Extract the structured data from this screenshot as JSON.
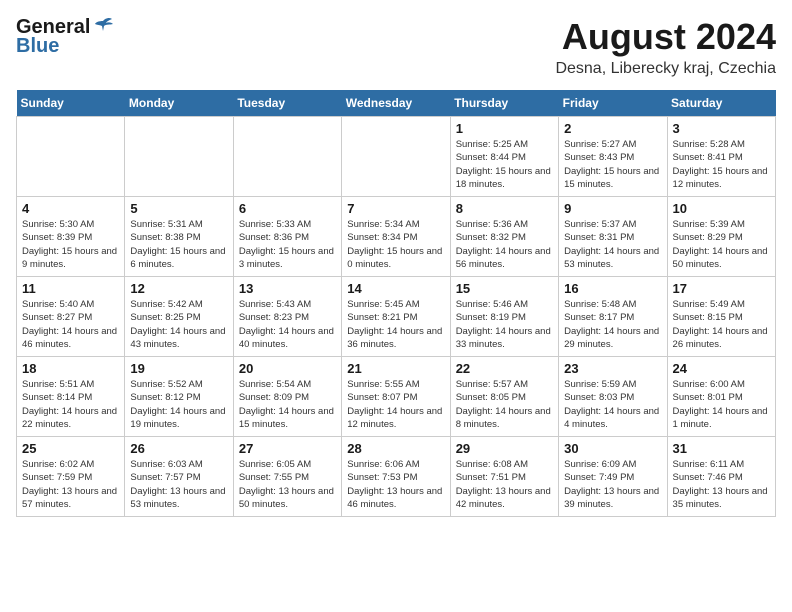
{
  "header": {
    "logo_general": "General",
    "logo_blue": "Blue",
    "month": "August 2024",
    "location": "Desna, Liberecky kraj, Czechia"
  },
  "columns": [
    "Sunday",
    "Monday",
    "Tuesday",
    "Wednesday",
    "Thursday",
    "Friday",
    "Saturday"
  ],
  "weeks": [
    [
      {
        "day": "",
        "empty": true
      },
      {
        "day": "",
        "empty": true
      },
      {
        "day": "",
        "empty": true
      },
      {
        "day": "",
        "empty": true
      },
      {
        "day": "1",
        "sunrise": "5:25 AM",
        "sunset": "8:44 PM",
        "daylight": "15 hours and 18 minutes."
      },
      {
        "day": "2",
        "sunrise": "5:27 AM",
        "sunset": "8:43 PM",
        "daylight": "15 hours and 15 minutes."
      },
      {
        "day": "3",
        "sunrise": "5:28 AM",
        "sunset": "8:41 PM",
        "daylight": "15 hours and 12 minutes."
      }
    ],
    [
      {
        "day": "4",
        "sunrise": "5:30 AM",
        "sunset": "8:39 PM",
        "daylight": "15 hours and 9 minutes."
      },
      {
        "day": "5",
        "sunrise": "5:31 AM",
        "sunset": "8:38 PM",
        "daylight": "15 hours and 6 minutes."
      },
      {
        "day": "6",
        "sunrise": "5:33 AM",
        "sunset": "8:36 PM",
        "daylight": "15 hours and 3 minutes."
      },
      {
        "day": "7",
        "sunrise": "5:34 AM",
        "sunset": "8:34 PM",
        "daylight": "15 hours and 0 minutes."
      },
      {
        "day": "8",
        "sunrise": "5:36 AM",
        "sunset": "8:32 PM",
        "daylight": "14 hours and 56 minutes."
      },
      {
        "day": "9",
        "sunrise": "5:37 AM",
        "sunset": "8:31 PM",
        "daylight": "14 hours and 53 minutes."
      },
      {
        "day": "10",
        "sunrise": "5:39 AM",
        "sunset": "8:29 PM",
        "daylight": "14 hours and 50 minutes."
      }
    ],
    [
      {
        "day": "11",
        "sunrise": "5:40 AM",
        "sunset": "8:27 PM",
        "daylight": "14 hours and 46 minutes."
      },
      {
        "day": "12",
        "sunrise": "5:42 AM",
        "sunset": "8:25 PM",
        "daylight": "14 hours and 43 minutes."
      },
      {
        "day": "13",
        "sunrise": "5:43 AM",
        "sunset": "8:23 PM",
        "daylight": "14 hours and 40 minutes."
      },
      {
        "day": "14",
        "sunrise": "5:45 AM",
        "sunset": "8:21 PM",
        "daylight": "14 hours and 36 minutes."
      },
      {
        "day": "15",
        "sunrise": "5:46 AM",
        "sunset": "8:19 PM",
        "daylight": "14 hours and 33 minutes."
      },
      {
        "day": "16",
        "sunrise": "5:48 AM",
        "sunset": "8:17 PM",
        "daylight": "14 hours and 29 minutes."
      },
      {
        "day": "17",
        "sunrise": "5:49 AM",
        "sunset": "8:15 PM",
        "daylight": "14 hours and 26 minutes."
      }
    ],
    [
      {
        "day": "18",
        "sunrise": "5:51 AM",
        "sunset": "8:14 PM",
        "daylight": "14 hours and 22 minutes."
      },
      {
        "day": "19",
        "sunrise": "5:52 AM",
        "sunset": "8:12 PM",
        "daylight": "14 hours and 19 minutes."
      },
      {
        "day": "20",
        "sunrise": "5:54 AM",
        "sunset": "8:09 PM",
        "daylight": "14 hours and 15 minutes."
      },
      {
        "day": "21",
        "sunrise": "5:55 AM",
        "sunset": "8:07 PM",
        "daylight": "14 hours and 12 minutes."
      },
      {
        "day": "22",
        "sunrise": "5:57 AM",
        "sunset": "8:05 PM",
        "daylight": "14 hours and 8 minutes."
      },
      {
        "day": "23",
        "sunrise": "5:59 AM",
        "sunset": "8:03 PM",
        "daylight": "14 hours and 4 minutes."
      },
      {
        "day": "24",
        "sunrise": "6:00 AM",
        "sunset": "8:01 PM",
        "daylight": "14 hours and 1 minute."
      }
    ],
    [
      {
        "day": "25",
        "sunrise": "6:02 AM",
        "sunset": "7:59 PM",
        "daylight": "13 hours and 57 minutes."
      },
      {
        "day": "26",
        "sunrise": "6:03 AM",
        "sunset": "7:57 PM",
        "daylight": "13 hours and 53 minutes."
      },
      {
        "day": "27",
        "sunrise": "6:05 AM",
        "sunset": "7:55 PM",
        "daylight": "13 hours and 50 minutes."
      },
      {
        "day": "28",
        "sunrise": "6:06 AM",
        "sunset": "7:53 PM",
        "daylight": "13 hours and 46 minutes."
      },
      {
        "day": "29",
        "sunrise": "6:08 AM",
        "sunset": "7:51 PM",
        "daylight": "13 hours and 42 minutes."
      },
      {
        "day": "30",
        "sunrise": "6:09 AM",
        "sunset": "7:49 PM",
        "daylight": "13 hours and 39 minutes."
      },
      {
        "day": "31",
        "sunrise": "6:11 AM",
        "sunset": "7:46 PM",
        "daylight": "13 hours and 35 minutes."
      }
    ]
  ]
}
